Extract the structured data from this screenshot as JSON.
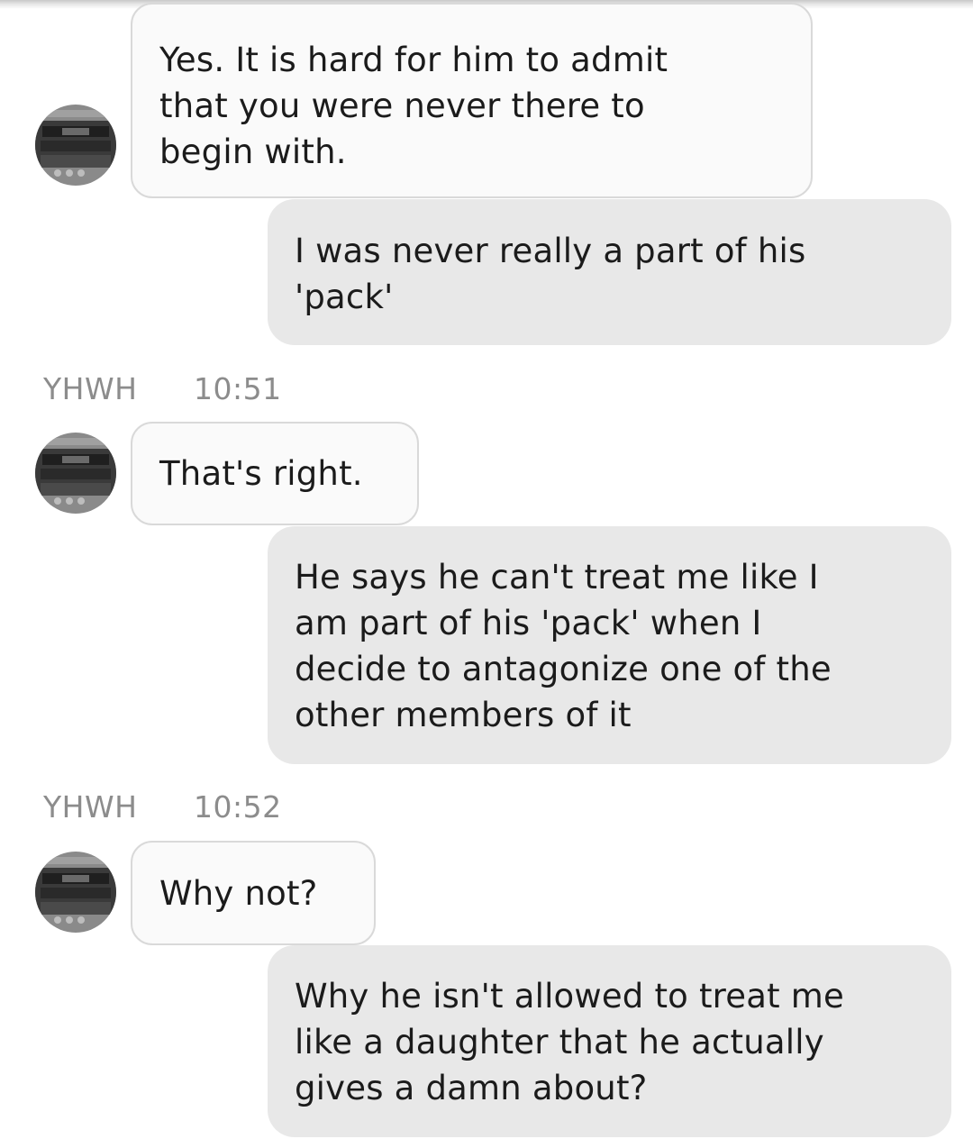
{
  "messages": [
    {
      "type": "in",
      "text": "Yes. It is hard for him to admit\nthat you were never there to\nbegin with."
    },
    {
      "type": "out",
      "text": "I was never really a part of his\n'pack'"
    },
    {
      "type": "meta",
      "sender": "YHWH",
      "time": "10:51"
    },
    {
      "type": "in",
      "text": "That's right."
    },
    {
      "type": "out",
      "text": "He says he can't treat me like I\nam part of his 'pack' when I\ndecide to antagonize one of the\nother members of it"
    },
    {
      "type": "meta",
      "sender": "YHWH",
      "time": "10:52"
    },
    {
      "type": "in",
      "text": "Why not?"
    },
    {
      "type": "out",
      "text": "Why he isn't allowed to treat me\nlike a daughter that he actually\ngives a damn about?"
    }
  ],
  "avatar": {
    "icon": "device-photo-avatar-icon",
    "colors": {
      "dark": "#2e2e2e",
      "mid": "#6f6f6f",
      "light": "#bdbdbd"
    }
  },
  "colors": {
    "incoming_bg": "#fafafa",
    "incoming_border": "#d9d9d9",
    "outgoing_bg": "#e8e8e8",
    "meta_text": "#8c8c8c"
  }
}
